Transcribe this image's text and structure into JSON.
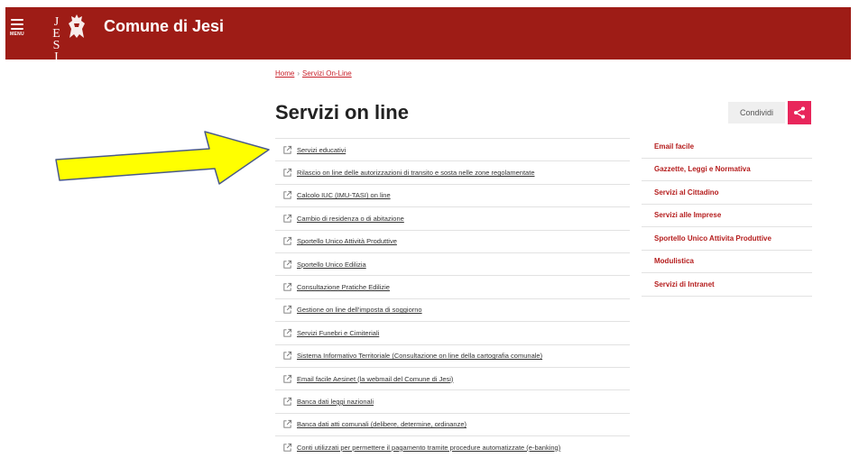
{
  "header": {
    "menu_label": "MENU",
    "logo_text": "JESI",
    "site_title": "Comune di Jesi"
  },
  "breadcrumb": {
    "home": "Home",
    "separator": "›",
    "current": "Servizi On-Line"
  },
  "page_title": "Servizi on line",
  "share": {
    "label": "Condividi"
  },
  "services": [
    "Servizi educativi",
    "Rilascio on line delle autorizzazioni di transito e sosta nelle zone regolamentate",
    "Calcolo IUC (IMU-TASI) on line",
    "Cambio di residenza o di abitazione",
    "Sportello Unico Attività Produttive",
    "Sportello Unico Edilizia",
    "Consultazione Pratiche Edilizie",
    "Gestione on line dell'imposta di soggiorno",
    "Servizi Funebri e Cimiteriali",
    "Sistema Informativo Territoriale (Consultazione on line della cartografia comunale)",
    "Email facile Aesinet (la webmail del Comune di Jesi)",
    "Banca dati leggi nazionali",
    "Banca dati atti comunali (delibere, determine, ordinanze)",
    "Conti utilizzati per permettere il pagamento tramite procedure automatizzate (e-banking)"
  ],
  "sidebar": [
    "Email facile",
    "Gazzette, Leggi e Normativa",
    "Servizi al Cittadino",
    "Servizi alle Imprese",
    "Sportello Unico Attivita Produttive",
    "Modulistica",
    "Servizi di Intranet"
  ],
  "colors": {
    "header_bg": "#9e1c16",
    "share_accent": "#e8265b",
    "sidebar_link": "#b51d1d",
    "annotation_arrow": "#ffff00"
  }
}
